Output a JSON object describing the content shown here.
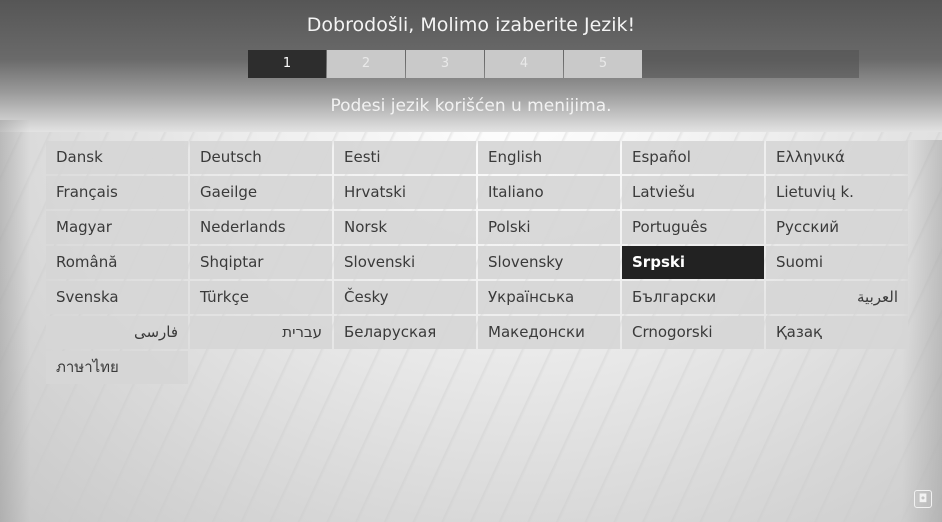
{
  "header": {
    "title": "Dobrodošli, Molimo izaberite Jezik!",
    "subtitle": "Podesi jezik korišćen u menijima."
  },
  "steps": [
    {
      "label": "1",
      "active": true
    },
    {
      "label": "2",
      "active": false
    },
    {
      "label": "3",
      "active": false
    },
    {
      "label": "4",
      "active": false
    },
    {
      "label": "5",
      "active": false
    }
  ],
  "languages": [
    {
      "label": "Dansk"
    },
    {
      "label": "Deutsch"
    },
    {
      "label": "Eesti"
    },
    {
      "label": "English"
    },
    {
      "label": "Español"
    },
    {
      "label": "Ελληνικά"
    },
    {
      "label": "Français"
    },
    {
      "label": "Gaeilge"
    },
    {
      "label": "Hrvatski"
    },
    {
      "label": "Italiano"
    },
    {
      "label": "Latviešu"
    },
    {
      "label": "Lietuvių k."
    },
    {
      "label": "Magyar"
    },
    {
      "label": "Nederlands"
    },
    {
      "label": "Norsk"
    },
    {
      "label": "Polski"
    },
    {
      "label": "Português"
    },
    {
      "label": "Русский"
    },
    {
      "label": "Română"
    },
    {
      "label": "Shqiptar"
    },
    {
      "label": "Slovenski"
    },
    {
      "label": "Slovensky"
    },
    {
      "label": "Srpski",
      "selected": true
    },
    {
      "label": "Suomi"
    },
    {
      "label": "Svenska"
    },
    {
      "label": "Türkçe"
    },
    {
      "label": "Česky"
    },
    {
      "label": "Українська"
    },
    {
      "label": "Български"
    },
    {
      "label": "العربية",
      "rtl": true
    },
    {
      "label": "فارسی",
      "rtl": true
    },
    {
      "label": "עברית",
      "rtl": true
    },
    {
      "label": "Беларуская"
    },
    {
      "label": "Македонски"
    },
    {
      "label": "Crnogorski"
    },
    {
      "label": "Қазақ"
    },
    {
      "label": "ภาษาไทย"
    }
  ],
  "colors": {
    "selected_bg": "#222222",
    "cell_bg": "#d6d6d6",
    "active_step_bg": "#2d2d2d"
  }
}
